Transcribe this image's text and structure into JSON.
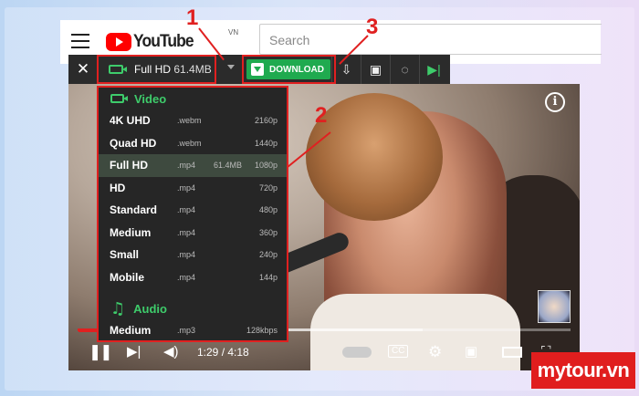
{
  "youtube": {
    "logo_text": "YouTube",
    "country": "VN",
    "search_placeholder": "Search"
  },
  "downloader_bar": {
    "close": "✕",
    "selected_quality": "Full HD",
    "selected_size": "61.4MB",
    "download_label": "DOWNLOAD"
  },
  "quality_menu": {
    "video_heading": "Video",
    "video_items": [
      {
        "name": "4K UHD",
        "format": ".webm",
        "size": "",
        "res": "2160p",
        "selected": false
      },
      {
        "name": "Quad HD",
        "format": ".webm",
        "size": "",
        "res": "1440p",
        "selected": false
      },
      {
        "name": "Full HD",
        "format": ".mp4",
        "size": "61.4MB",
        "res": "1080p",
        "selected": true
      },
      {
        "name": "HD",
        "format": ".mp4",
        "size": "",
        "res": "720p",
        "selected": false
      },
      {
        "name": "Standard",
        "format": ".mp4",
        "size": "",
        "res": "480p",
        "selected": false
      },
      {
        "name": "Medium",
        "format": ".mp4",
        "size": "",
        "res": "360p",
        "selected": false
      },
      {
        "name": "Small",
        "format": ".mp4",
        "size": "",
        "res": "240p",
        "selected": false
      },
      {
        "name": "Mobile",
        "format": ".mp4",
        "size": "",
        "res": "144p",
        "selected": false
      }
    ],
    "audio_heading": "Audio",
    "audio_items": [
      {
        "name": "Medium",
        "format": ".mp3",
        "size": "",
        "res": "128kbps"
      }
    ]
  },
  "player": {
    "time_current": "1:29",
    "time_total": "4:18",
    "progress": 0.345
  },
  "annotations": {
    "label_1": "1",
    "label_2": "2",
    "label_3": "3"
  },
  "brand": {
    "text": "mytour.vn"
  },
  "colors": {
    "accent_green": "#3ecc6b",
    "annotation_red": "#e02020",
    "brand_red": "#e01e1e"
  }
}
